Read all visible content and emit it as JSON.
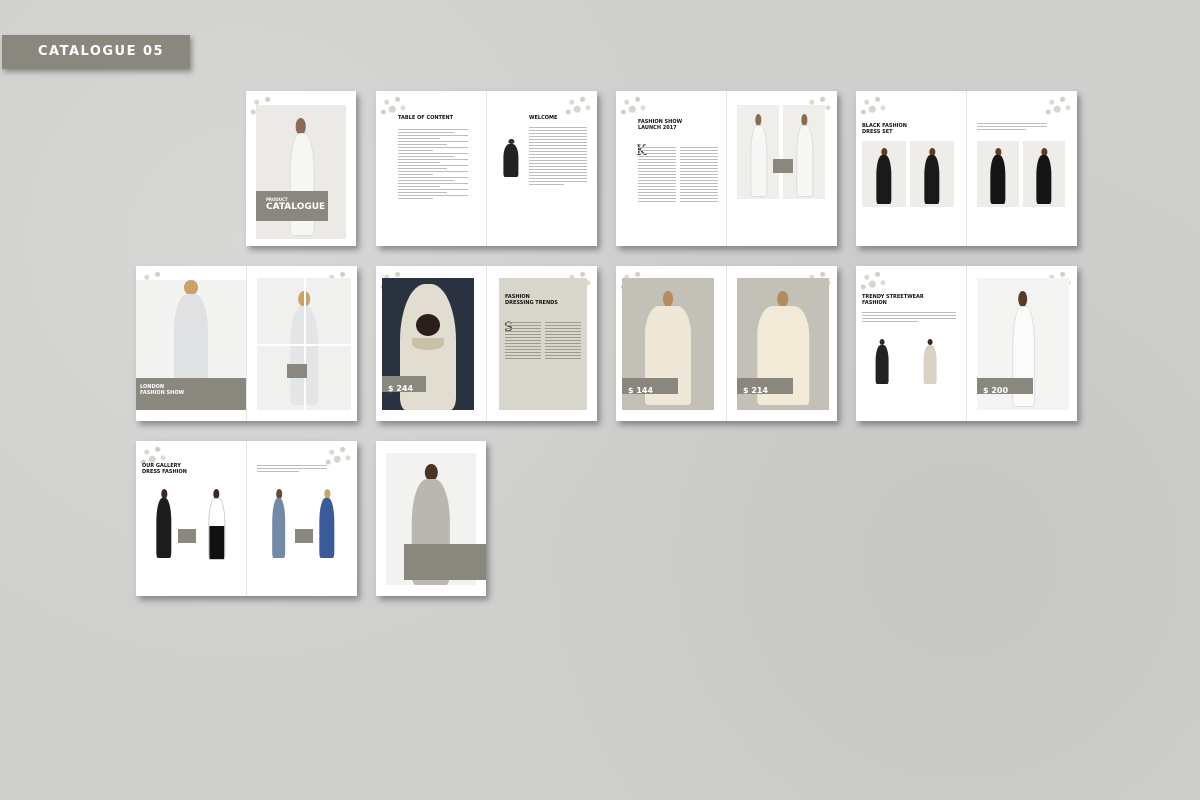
{
  "header": {
    "tag_label": "CATALOGUE 05"
  },
  "cover": {
    "small_title": "PRODUCT",
    "big_title": "CATALOGUE"
  },
  "contents": {
    "title": "TABLE OF CONTENT",
    "welcome": "WELCOME"
  },
  "fashion_show": {
    "title_line1": "FASHION SHOW",
    "title_line2": "LAUNCH 2017",
    "drop_cap": "K"
  },
  "black_fashion": {
    "title_line1": "BLACK FASHION",
    "title_line2": "DRESS SET"
  },
  "london": {
    "title_line1": "LONDON",
    "title_line2": "FASHION SHOW"
  },
  "hood": {
    "price": "$ 244"
  },
  "fashion_trends": {
    "title_line1": "FASHION",
    "title_line2": "DRESSING TRENDS",
    "drop_cap": "S"
  },
  "gowns": {
    "price_left": "$ 144",
    "price_right": "$ 214"
  },
  "streetwear": {
    "title_line1": "TRENDY STREETWEAR",
    "title_line2": "FASHION",
    "price": "$ 200"
  },
  "everyday": {
    "title_line1": "OUR GALLERY",
    "title_line2": "DRESS FASHION"
  },
  "colors": {
    "accent": "#8a887e",
    "background": "#cfcfcd",
    "page": "#ffffff"
  }
}
